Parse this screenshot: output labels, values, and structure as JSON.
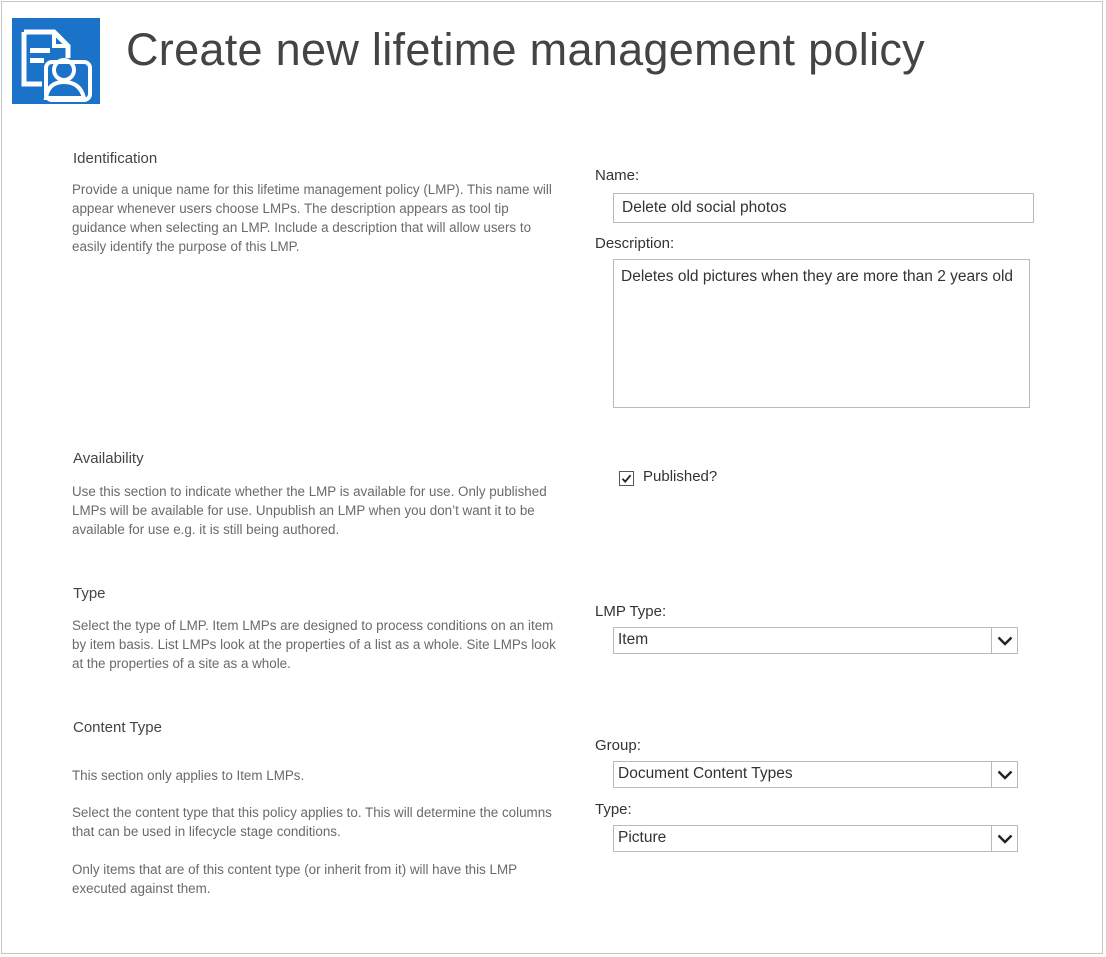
{
  "header": {
    "title": "Create new lifetime management policy",
    "logo_icon": "policy-document-icon",
    "accent": "#1a73c8"
  },
  "identification": {
    "title": "Identification",
    "description": "Provide a unique name for this lifetime management policy (LMP). This name will appear whenever users choose LMPs. The description appears as tool tip guidance when selecting an LMP. Include a description that will allow users to easily identify the purpose of this LMP.",
    "name_label": "Name:",
    "name_value": "Delete old social photos",
    "description_label": "Description:",
    "description_value": "Deletes old pictures when they are more than 2 years old"
  },
  "availability": {
    "title": "Availability",
    "description": "Use this section to indicate whether the LMP is available for use. Only published LMPs will be available for use. Unpublish an LMP when you don’t want it to be available for use e.g. it is still being authored.",
    "published_label": "Published?",
    "published_checked": true
  },
  "type_section": {
    "title": "Type",
    "description": "Select the type of LMP. Item LMPs are designed to process conditions on an item by item basis. List LMPs look at the properties of a list as a whole. Site LMPs look at the properties of a site as a whole.",
    "lmp_type_label": "LMP Type:",
    "lmp_type_value": "Item"
  },
  "content_type": {
    "title": "Content Type",
    "desc1": "This section only applies to Item LMPs.",
    "desc2": "Select the content type that this policy applies to. This will determine the columns that can be used in lifecycle stage conditions.",
    "desc3": "Only items that are of this content type (or inherit from it) will have this LMP executed against them.",
    "group_label": "Group:",
    "group_value": "Document Content Types",
    "type_label": "Type:",
    "type_value": "Picture"
  }
}
